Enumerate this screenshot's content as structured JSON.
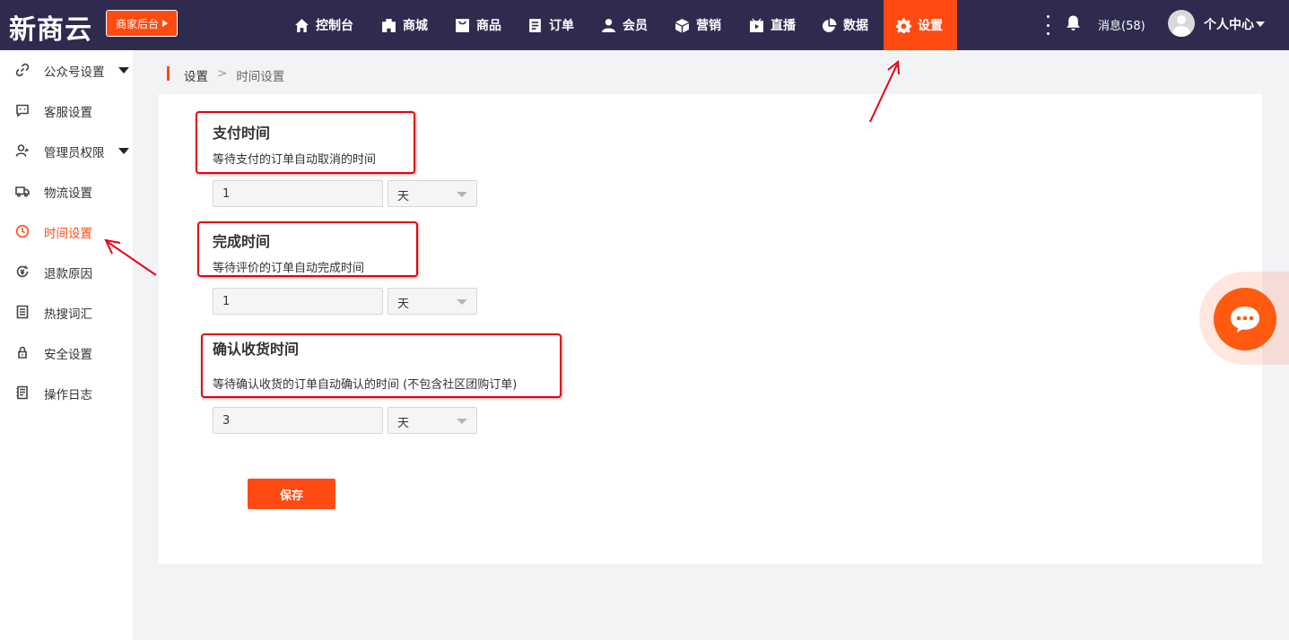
{
  "header": {
    "logo": "新商云",
    "merchant_button": "商家后台",
    "nav": [
      {
        "label": "控制台",
        "icon": "home-icon"
      },
      {
        "label": "商城",
        "icon": "building-icon"
      },
      {
        "label": "商品",
        "icon": "bag-icon"
      },
      {
        "label": "订单",
        "icon": "order-icon"
      },
      {
        "label": "会员",
        "icon": "user-icon"
      },
      {
        "label": "营销",
        "icon": "box-icon"
      },
      {
        "label": "直播",
        "icon": "live-icon"
      },
      {
        "label": "数据",
        "icon": "pie-icon"
      },
      {
        "label": "设置",
        "icon": "gear-icon",
        "active": true
      }
    ],
    "messages": "消息(58)",
    "user_center": "个人中心"
  },
  "sidebar": {
    "items": [
      {
        "label": "公众号设置",
        "icon": "link-icon",
        "has_submenu": true
      },
      {
        "label": "客服设置",
        "icon": "chat-icon"
      },
      {
        "label": "管理员权限",
        "icon": "admin-icon",
        "has_submenu": true
      },
      {
        "label": "物流设置",
        "icon": "truck-icon"
      },
      {
        "label": "时间设置",
        "icon": "clock-icon",
        "active": true
      },
      {
        "label": "退款原因",
        "icon": "refund-icon"
      },
      {
        "label": "热搜词汇",
        "icon": "list-icon"
      },
      {
        "label": "安全设置",
        "icon": "lock-icon"
      },
      {
        "label": "操作日志",
        "icon": "log-icon"
      }
    ]
  },
  "breadcrumb": {
    "root": "设置",
    "separator": ">",
    "current": "时间设置"
  },
  "sections": [
    {
      "title": "支付时间",
      "desc": "等待支付的订单自动取消的时间",
      "value": "1",
      "unit": "天"
    },
    {
      "title": "完成时间",
      "desc": "等待评价的订单自动完成时间",
      "value": "1",
      "unit": "天"
    },
    {
      "title": "确认收货时间",
      "desc": "等待确认收货的订单自动确认的时间 (不包含社区团购订单)",
      "value": "3",
      "unit": "天"
    }
  ],
  "save_label": "保存",
  "colors": {
    "topbar": "#2e2b4f",
    "accent": "#ff4a12",
    "highlight": "#e60012"
  }
}
